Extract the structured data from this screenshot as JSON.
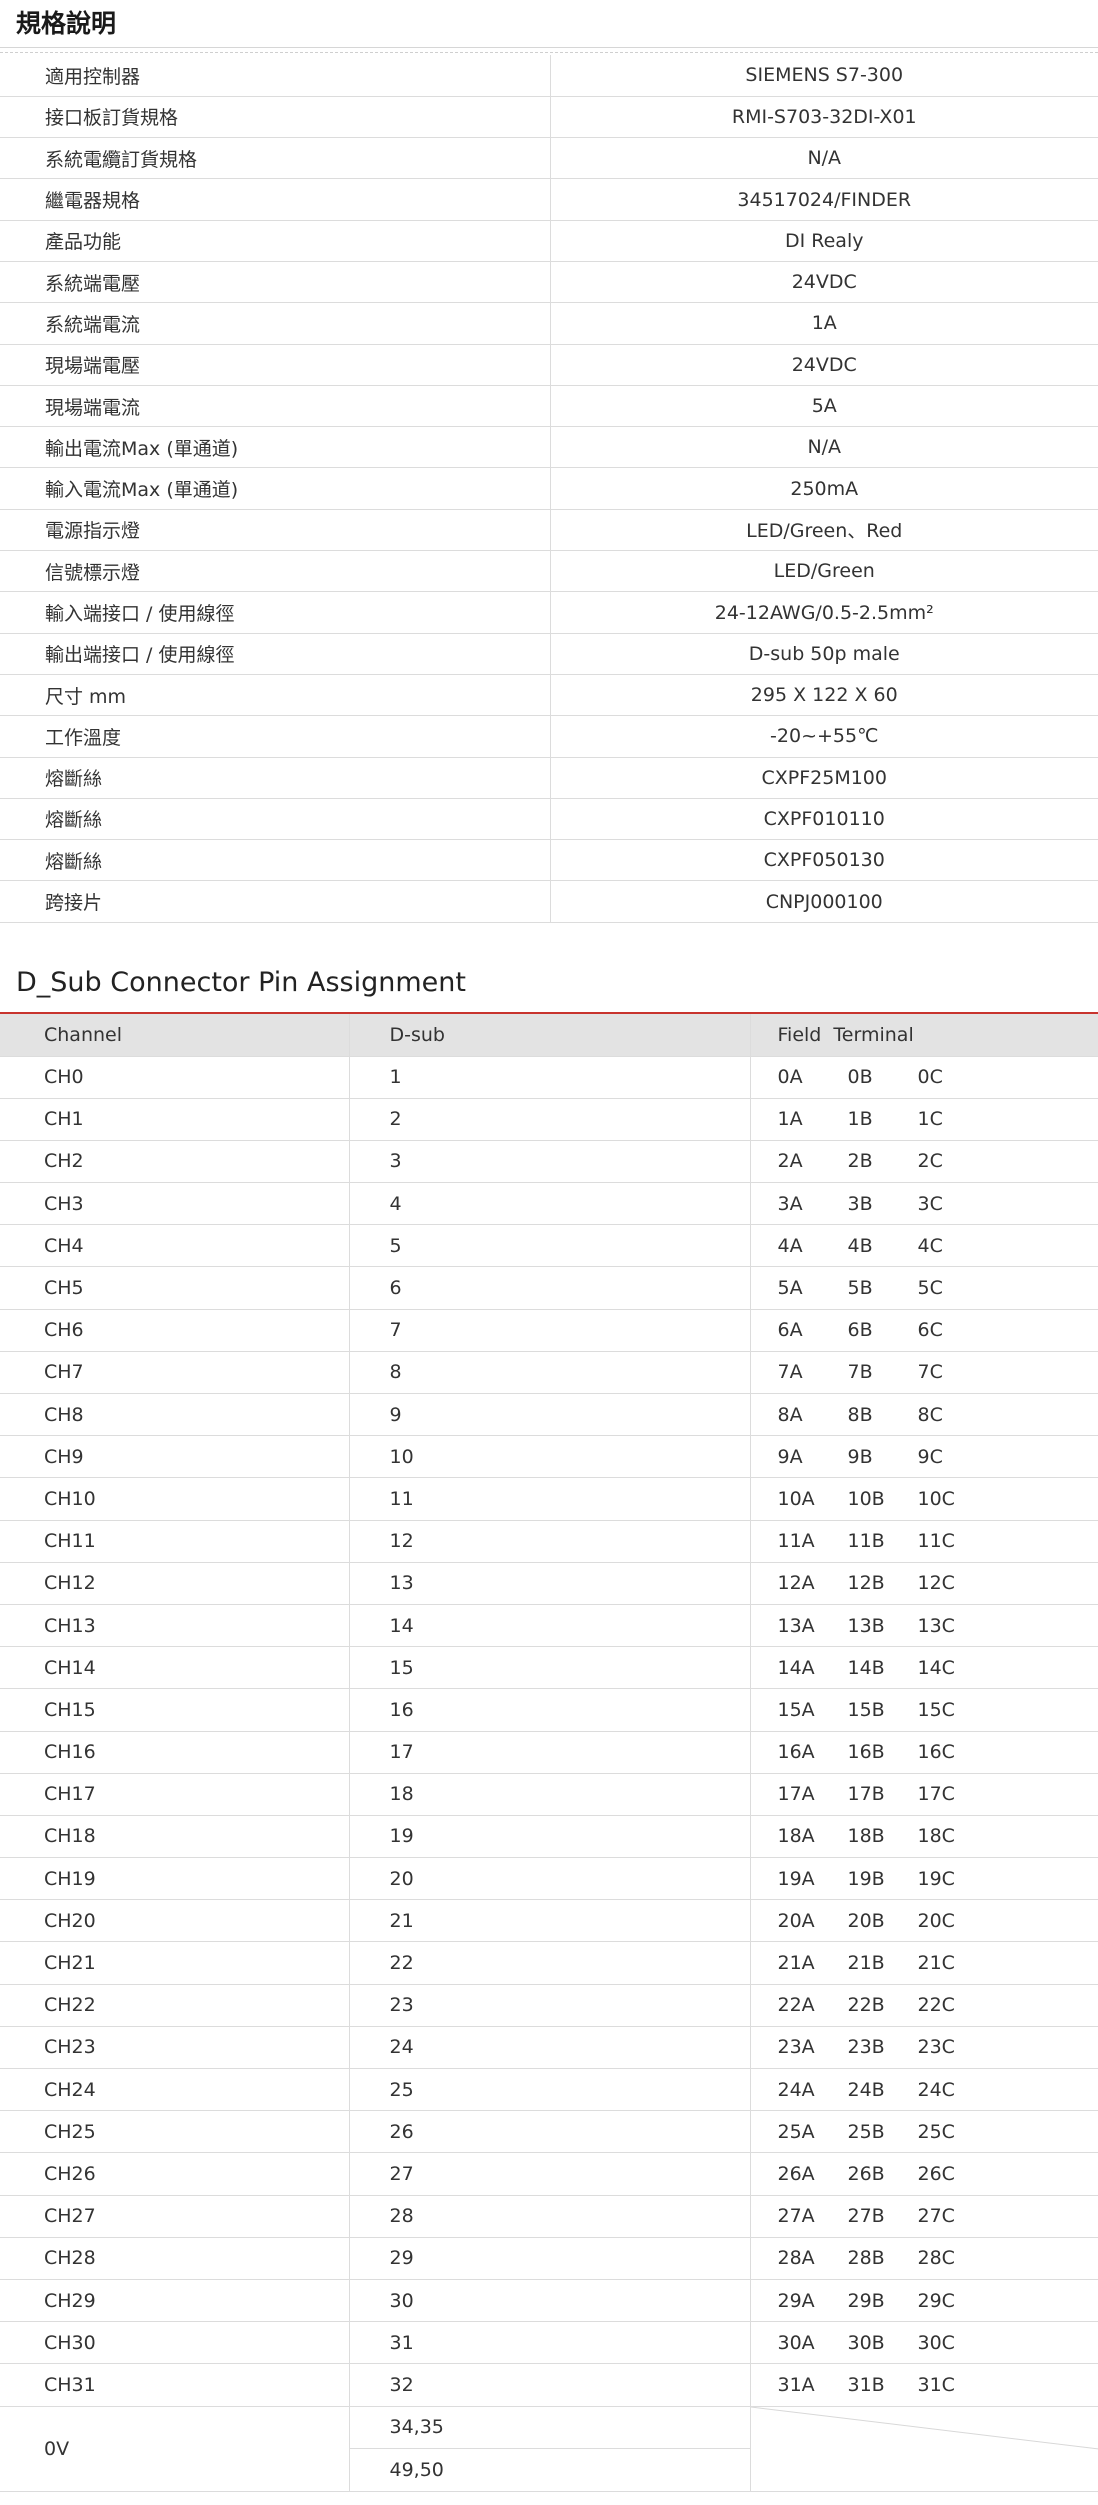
{
  "spec": {
    "title": "規格說明",
    "rows": [
      {
        "label": "適用控制器",
        "value": "SIEMENS S7-300"
      },
      {
        "label": "接口板訂貨規格",
        "value": "RMI-S703-32DI-X01"
      },
      {
        "label": "系統電纜訂貨規格",
        "value": "N/A"
      },
      {
        "label": "繼電器規格",
        "value": "34517024/FINDER"
      },
      {
        "label": "產品功能",
        "value": "DI Realy"
      },
      {
        "label": "系統端電壓",
        "value": "24VDC"
      },
      {
        "label": "系統端電流",
        "value": "1A"
      },
      {
        "label": "現場端電壓",
        "value": "24VDC"
      },
      {
        "label": "現場端電流",
        "value": "5A"
      },
      {
        "label": "輸出電流Max (單通道)",
        "value": "N/A"
      },
      {
        "label": "輸入電流Max (單通道)",
        "value": "250mA"
      },
      {
        "label": "電源指示燈",
        "value": "LED/Green、Red"
      },
      {
        "label": "信號標示燈",
        "value": "LED/Green"
      },
      {
        "label": "輸入端接口 / 使用線徑",
        "value": "24-12AWG/0.5-2.5mm²"
      },
      {
        "label": "輸出端接口 / 使用線徑",
        "value": "D-sub 50p male"
      },
      {
        "label": "尺寸 mm",
        "value": "295 X 122 X 60"
      },
      {
        "label": "工作溫度",
        "value": "-20~+55℃"
      },
      {
        "label": "熔斷絲",
        "value": "CXPF25M100"
      },
      {
        "label": "熔斷絲",
        "value": "CXPF010110"
      },
      {
        "label": "熔斷絲",
        "value": "CXPF050130"
      },
      {
        "label": "跨接片",
        "value": "CNPJ000100"
      }
    ]
  },
  "pins": {
    "title": "D_Sub Connector Pin Assignment",
    "headers": [
      "Channel",
      "D-sub",
      "Field  Terminal"
    ],
    "rows": [
      {
        "channel": "CH0",
        "dsub": "1",
        "a": "0A",
        "b": "0B",
        "c": "0C"
      },
      {
        "channel": "CH1",
        "dsub": "2",
        "a": "1A",
        "b": "1B",
        "c": "1C"
      },
      {
        "channel": "CH2",
        "dsub": "3",
        "a": "2A",
        "b": "2B",
        "c": "2C"
      },
      {
        "channel": "CH3",
        "dsub": "4",
        "a": "3A",
        "b": "3B",
        "c": "3C"
      },
      {
        "channel": "CH4",
        "dsub": "5",
        "a": "4A",
        "b": "4B",
        "c": "4C"
      },
      {
        "channel": "CH5",
        "dsub": "6",
        "a": "5A",
        "b": "5B",
        "c": "5C"
      },
      {
        "channel": "CH6",
        "dsub": "7",
        "a": "6A",
        "b": "6B",
        "c": "6C"
      },
      {
        "channel": "CH7",
        "dsub": "8",
        "a": "7A",
        "b": "7B",
        "c": "7C"
      },
      {
        "channel": "CH8",
        "dsub": "9",
        "a": "8A",
        "b": "8B",
        "c": "8C"
      },
      {
        "channel": "CH9",
        "dsub": "10",
        "a": "9A",
        "b": "9B",
        "c": "9C"
      },
      {
        "channel": "CH10",
        "dsub": "11",
        "a": "10A",
        "b": "10B",
        "c": "10C"
      },
      {
        "channel": "CH11",
        "dsub": "12",
        "a": "11A",
        "b": "11B",
        "c": "11C"
      },
      {
        "channel": "CH12",
        "dsub": "13",
        "a": "12A",
        "b": "12B",
        "c": "12C"
      },
      {
        "channel": "CH13",
        "dsub": "14",
        "a": "13A",
        "b": "13B",
        "c": "13C"
      },
      {
        "channel": "CH14",
        "dsub": "15",
        "a": "14A",
        "b": "14B",
        "c": "14C"
      },
      {
        "channel": "CH15",
        "dsub": "16",
        "a": "15A",
        "b": "15B",
        "c": "15C"
      },
      {
        "channel": "CH16",
        "dsub": "17",
        "a": "16A",
        "b": "16B",
        "c": "16C"
      },
      {
        "channel": "CH17",
        "dsub": "18",
        "a": "17A",
        "b": "17B",
        "c": "17C"
      },
      {
        "channel": "CH18",
        "dsub": "19",
        "a": "18A",
        "b": "18B",
        "c": "18C"
      },
      {
        "channel": "CH19",
        "dsub": "20",
        "a": "19A",
        "b": "19B",
        "c": "19C"
      },
      {
        "channel": "CH20",
        "dsub": "21",
        "a": "20A",
        "b": "20B",
        "c": "20C"
      },
      {
        "channel": "CH21",
        "dsub": "22",
        "a": "21A",
        "b": "21B",
        "c": "21C"
      },
      {
        "channel": "CH22",
        "dsub": "23",
        "a": "22A",
        "b": "22B",
        "c": "22C"
      },
      {
        "channel": "CH23",
        "dsub": "24",
        "a": "23A",
        "b": "23B",
        "c": "23C"
      },
      {
        "channel": "CH24",
        "dsub": "25",
        "a": "24A",
        "b": "24B",
        "c": "24C"
      },
      {
        "channel": "CH25",
        "dsub": "26",
        "a": "25A",
        "b": "25B",
        "c": "25C"
      },
      {
        "channel": "CH26",
        "dsub": "27",
        "a": "26A",
        "b": "26B",
        "c": "26C"
      },
      {
        "channel": "CH27",
        "dsub": "28",
        "a": "27A",
        "b": "27B",
        "c": "27C"
      },
      {
        "channel": "CH28",
        "dsub": "29",
        "a": "28A",
        "b": "28B",
        "c": "28C"
      },
      {
        "channel": "CH29",
        "dsub": "30",
        "a": "29A",
        "b": "29B",
        "c": "29C"
      },
      {
        "channel": "CH30",
        "dsub": "31",
        "a": "30A",
        "b": "30B",
        "c": "30C"
      },
      {
        "channel": "CH31",
        "dsub": "32",
        "a": "31A",
        "b": "31B",
        "c": "31C"
      }
    ],
    "zero_v": {
      "channel": "0V",
      "dsub": [
        "34,35",
        "49,50"
      ]
    }
  }
}
